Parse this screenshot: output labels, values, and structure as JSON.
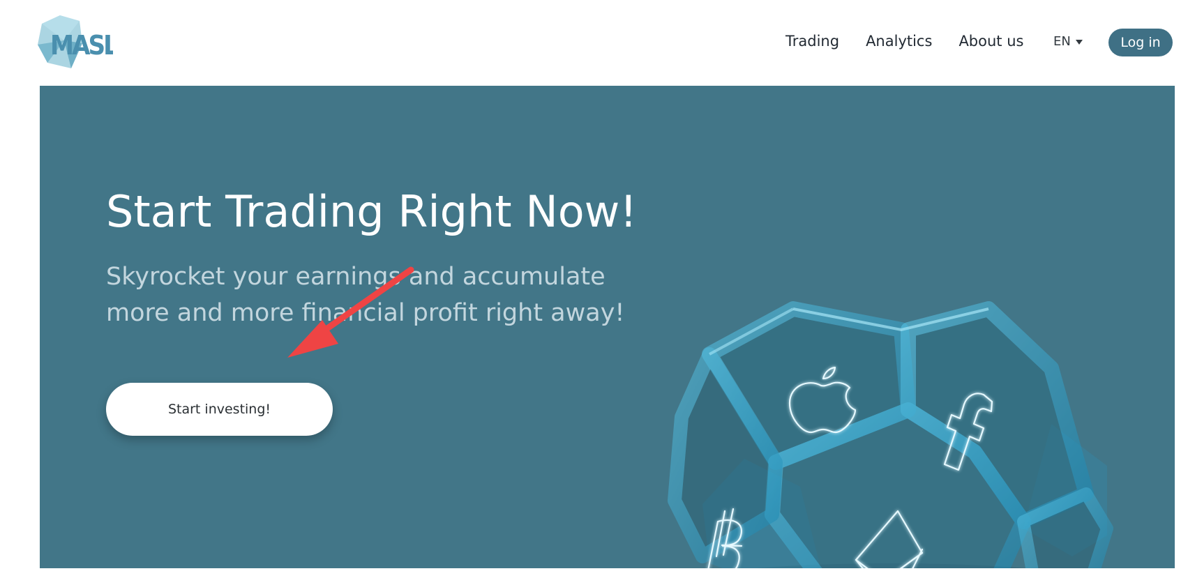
{
  "header": {
    "logo_text": "MASL",
    "nav": [
      {
        "label": "Trading"
      },
      {
        "label": "Analytics"
      },
      {
        "label": "About us"
      }
    ],
    "language": "EN",
    "login_label": "Log in"
  },
  "hero": {
    "title": "Start Trading Right Now!",
    "subtitle": "Skyrocket your earnings and accumulate more and more financial profit right away!",
    "cta_label": "Start investing!"
  },
  "colors": {
    "brand": "#3f7085",
    "hero_background": "#427688",
    "subtitle_text": "#c3d6de",
    "annotation_arrow": "#ef4444",
    "crystal": "#2aa5cf"
  },
  "icons": [
    "apple-icon",
    "facebook-icon",
    "bitcoin-icon",
    "ethereum-icon"
  ]
}
